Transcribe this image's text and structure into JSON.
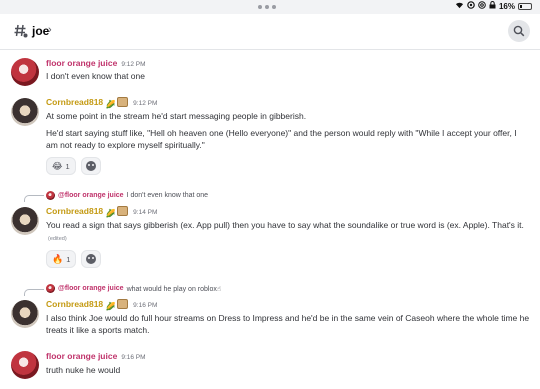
{
  "status_bar": {
    "battery": "16%",
    "battery_level": 0.16,
    "icons": [
      "wifi-icon",
      "focus-icon",
      "at-icon",
      "lock-icon"
    ]
  },
  "header": {
    "channel": "joe",
    "chevron": "›"
  },
  "messages": [
    {
      "author": "floor orange juice",
      "time": "9:12 PM",
      "text": "I don't even know that one"
    },
    {
      "author": "Cornbread818",
      "time": "9:12 PM",
      "text1": "At some point in the stream he'd start messaging people in gibberish.",
      "text2": "He'd start saying stuff like, \"Hell oh heaven one (Hello everyone)\" and the person would reply with \"While I accept your offer, I am not ready to explore myself spiritually.\"",
      "reaction": {
        "emoji": "😂",
        "count": "1"
      }
    },
    {
      "reply_to": "@floor orange juice",
      "reply_text": "I don't even know that one",
      "author": "Cornbread818",
      "time": "9:14 PM",
      "text": "You read a sign that says gibberish (ex. App pull) then you have to say what the soundalike or true word is (ex. Apple). That's it.",
      "edited": "(edited)",
      "reaction": {
        "emoji": "🔥",
        "count": "1"
      }
    },
    {
      "reply_to": "@floor orange juice",
      "reply_text": "what would he play on roblox☝",
      "author": "Cornbread818",
      "time": "9:16 PM",
      "text": "I also think Joe would do full hour streams on Dress to Impress and he'd be in the same vein of Caseoh where the whole time he treats it like a sports match."
    },
    {
      "author": "floor orange juice",
      "time": "9:16 PM",
      "text": "truth nuke he would"
    }
  ],
  "colors": {
    "pink_name": "#c0336b",
    "gold_name": "#c49a12",
    "background": "#ffffff"
  }
}
